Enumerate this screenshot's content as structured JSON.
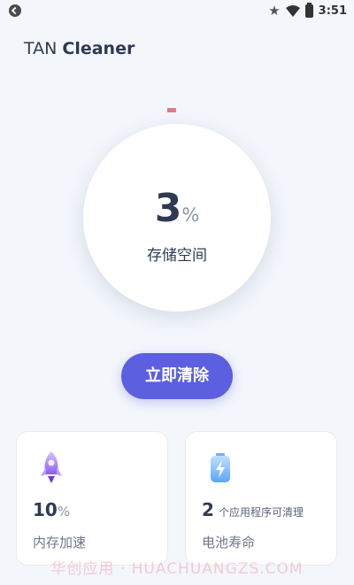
{
  "status_bar": {
    "time": "3:51",
    "icons": [
      "app-notification-icon",
      "star-icon",
      "wifi-icon",
      "battery-icon"
    ]
  },
  "header": {
    "title_light": "TAN",
    "title_bold": "Cleaner"
  },
  "storage": {
    "value": "3",
    "unit": "%",
    "label": "存储空间"
  },
  "actions": {
    "clean_label": "立即清除"
  },
  "cards": [
    {
      "icon": "rocket-icon",
      "value": "10",
      "unit": "%",
      "label": "内存加速"
    },
    {
      "icon": "battery-charge-icon",
      "value": "2",
      "suffix": "个应用程序可清理",
      "label": "电池寿命"
    }
  ],
  "watermark": "华创应用 · HUACHUANGZS.COM",
  "colors": {
    "accent": "#5b5fe0",
    "text_dark": "#2f3a52",
    "background": "#f3f6fb",
    "indicator": "#e0788c"
  }
}
